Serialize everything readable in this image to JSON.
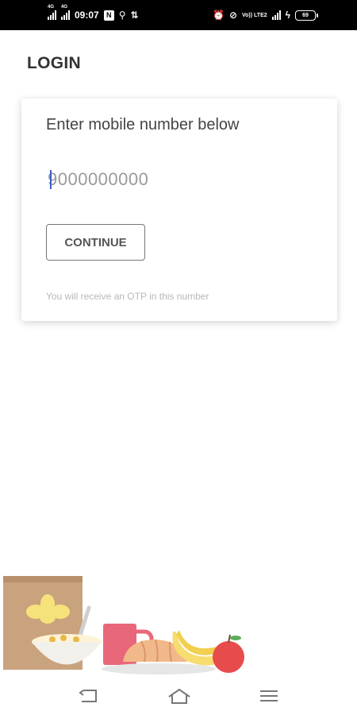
{
  "status_bar": {
    "time": "09:07",
    "notification_badge": "N",
    "network_label": "4G",
    "lte_label": "Vo)) LTE2",
    "battery_level": "69"
  },
  "page": {
    "title": "LOGIN"
  },
  "login_card": {
    "heading": "Enter mobile number below",
    "phone_placeholder": "9000000000",
    "continue_label": "CONTINUE",
    "helper_text": "You will receive an OTP in this number"
  },
  "nav_bar": {
    "icons": [
      "back-icon",
      "home-icon",
      "menu-icon"
    ]
  },
  "colors": {
    "accent_caret": "#3a5fcd",
    "card_shadow": "#d0d0d0",
    "title_text": "#333333"
  }
}
